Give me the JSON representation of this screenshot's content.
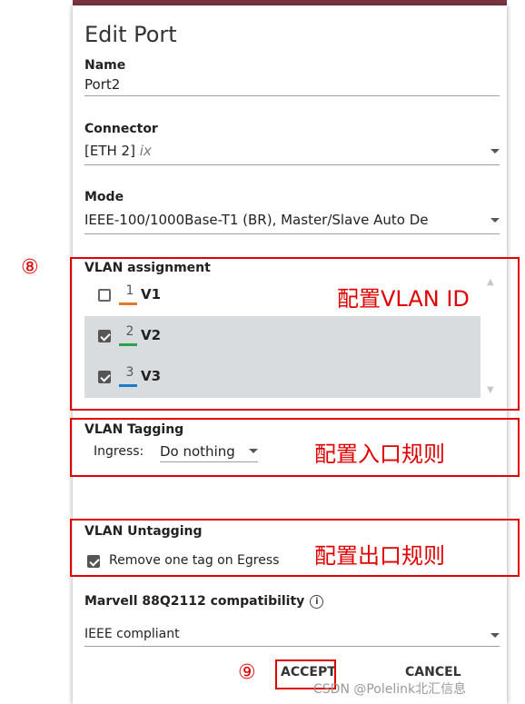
{
  "dialog": {
    "title": "Edit Port",
    "name_label": "Name",
    "name_value": "Port2",
    "connector_label": "Connector",
    "connector_value": "[ETH 2]",
    "connector_suffix": "ix",
    "mode_label": "Mode",
    "mode_value": "IEEE-100/1000Base-T1 (BR), Master/Slave Auto De",
    "vlan_assignment": {
      "label": "VLAN assignment",
      "items": [
        {
          "id": "1",
          "name": "V1",
          "checked": false,
          "color": "#e87722"
        },
        {
          "id": "2",
          "name": "V2",
          "checked": true,
          "color": "#2e9e4f"
        },
        {
          "id": "3",
          "name": "V3",
          "checked": true,
          "color": "#1f7ac9"
        }
      ]
    },
    "vlan_tagging": {
      "label": "VLAN Tagging",
      "ingress_label": "Ingress:",
      "ingress_value": "Do nothing"
    },
    "vlan_untagging": {
      "label": "VLAN Untagging",
      "remove_tag_label": "Remove one tag on Egress",
      "remove_tag_checked": true
    },
    "compat": {
      "label": "Marvell 88Q2112 compatibility",
      "info_icon": "i",
      "value": "IEEE compliant"
    },
    "accept_label": "ACCEPT",
    "cancel_label": "CANCEL"
  },
  "annotations": {
    "marker_8": "⑧",
    "marker_9": "⑨",
    "vlan_id_note": "配置VLAN ID",
    "ingress_note": "配置入口规则",
    "egress_note": "配置出口规则",
    "color": "#e00000"
  },
  "watermark": "CSDN @Polelink北汇信息",
  "colors": {
    "topbar": "#7a3442",
    "selected_row": "#d9dcdf"
  }
}
